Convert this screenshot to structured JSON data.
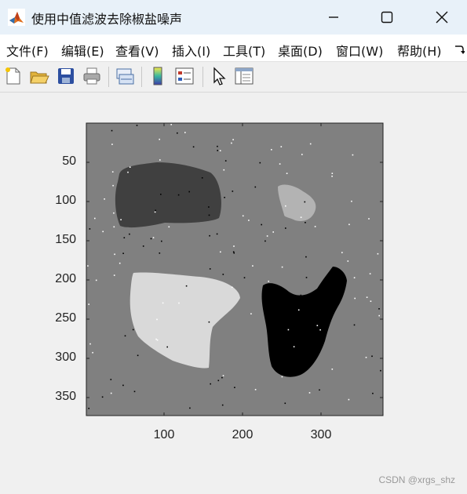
{
  "window": {
    "title": "使用中值滤波去除椒盐噪声"
  },
  "menu": {
    "items": [
      "文件(F)",
      "编辑(E)",
      "查看(V)",
      "插入(I)",
      "工具(T)",
      "桌面(D)",
      "窗口(W)",
      "帮助(H)"
    ]
  },
  "figure": {
    "y_ticks": [
      "50",
      "100",
      "150",
      "200",
      "250",
      "300",
      "350"
    ],
    "x_ticks": [
      "100",
      "200",
      "300"
    ]
  },
  "watermark": "CSDN @xrgs_shz",
  "colors": {
    "titlebar": "#e8f1f9",
    "background": "#808080",
    "dark_blob": "#404040",
    "small_light_blob": "#b3b3b3",
    "white_blob": "#d9d9d9",
    "black_blob": "#000000"
  }
}
